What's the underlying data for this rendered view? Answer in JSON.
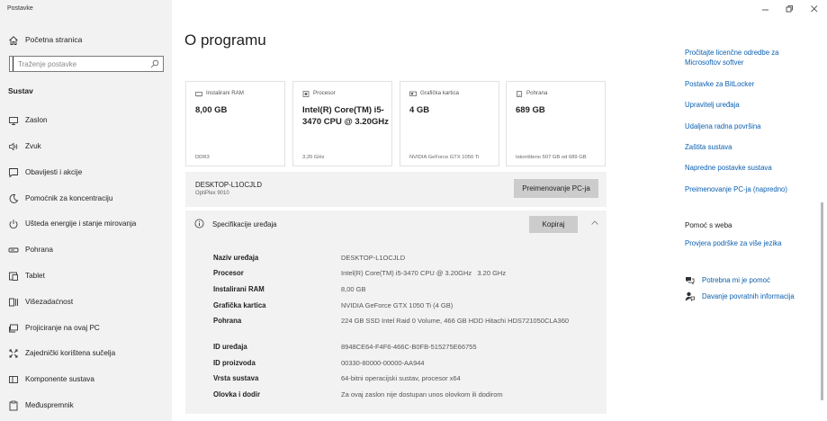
{
  "app": {
    "title": "Postavke"
  },
  "sidebar": {
    "home_label": "Početna stranica",
    "search_placeholder": "Traženje postavke",
    "section": "Sustav",
    "items": [
      {
        "label": "Zaslon",
        "icon": "monitor-icon"
      },
      {
        "label": "Zvuk",
        "icon": "speaker-icon"
      },
      {
        "label": "Obavijesti i akcije",
        "icon": "notification-icon"
      },
      {
        "label": "Pomoćnik za koncentraciju",
        "icon": "moon-icon"
      },
      {
        "label": "Ušteda energije i stanje mirovanja",
        "icon": "power-icon"
      },
      {
        "label": "Pohrana",
        "icon": "storage-icon"
      },
      {
        "label": "Tablet",
        "icon": "tablet-icon"
      },
      {
        "label": "Višezadaćnost",
        "icon": "multitask-icon"
      },
      {
        "label": "Projiciranje na ovaj PC",
        "icon": "projector-icon"
      },
      {
        "label": "Zajednički korištena sučelja",
        "icon": "shared-experiences-icon"
      },
      {
        "label": "Komponente sustava",
        "icon": "components-icon"
      },
      {
        "label": "Međuspremnik",
        "icon": "clipboard-icon"
      }
    ]
  },
  "main": {
    "title": "O programu",
    "cards": [
      {
        "title": "Instalirani RAM",
        "value": "8,00 GB",
        "footer": "DDR3",
        "icon": "ram-icon"
      },
      {
        "title": "Procesor",
        "value": "Intel(R) Core(TM) i5-3470 CPU @ 3.20GHz",
        "footer": "3,20 GHz",
        "icon": "cpu-icon"
      },
      {
        "title": "Grafička kartica",
        "value": "4 GB",
        "footer": "NVIDIA GeForce GTX 1050 Ti",
        "icon": "gpu-icon"
      },
      {
        "title": "Pohrana",
        "value": "689 GB",
        "footer": "Iskorišteno 507 GB od 689 GB",
        "icon": "drive-icon"
      }
    ],
    "device": {
      "name": "DESKTOP-L1OCJLD",
      "model": "OptiPlex 9010",
      "rename_label": "Preimenovanje PC-ja"
    },
    "specs": {
      "title": "Specifikacije uređaja",
      "copy_label": "Kopiraj",
      "rows": [
        {
          "key": "Naziv uređaja",
          "value": "DESKTOP-L1OCJLD"
        },
        {
          "key": "Procesor",
          "value": "Intel(R) Core(TM) i5-3470 CPU @ 3.20GHz   3.20 GHz"
        },
        {
          "key": "Instalirani RAM",
          "value": "8,00 GB"
        },
        {
          "key": "Grafička kartica",
          "value": "NVIDIA GeForce GTX 1050 Ti (4 GB)"
        },
        {
          "key": "Pohrana",
          "value": "224 GB SSD Intel Raid 0 Volume, 466 GB HDD Hitachi HDS721050CLA360"
        },
        {
          "key": "ID uređaja",
          "value": "8948CE64-F4F6-466C-B0FB-515275E66755"
        },
        {
          "key": "ID proizvoda",
          "value": "00330-80000-00000-AA944"
        },
        {
          "key": "Vrsta sustava",
          "value": "64-bitni operacijski sustav, procesor x64"
        },
        {
          "key": "Olovka i dodir",
          "value": "Za ovaj zaslon nije dostupan unos olovkom ili dodirom"
        }
      ]
    }
  },
  "related": {
    "links": [
      "Pročitajte licenčne odredbe za Microsoftov softver",
      "Postavke za BitLocker",
      "Upravitelj uređaja",
      "Udaljena radna površina",
      "Zaštita sustava",
      "Napredne postavke sustava",
      "Preimenovanje PC-ja (napredno)"
    ],
    "web_help_heading": "Pomoć s weba",
    "web_help_link": "Provjera podrške za više jezika",
    "help": [
      {
        "label": "Potrebna mi je pomoć",
        "icon": "help-chat-icon"
      },
      {
        "label": "Davanje povratnih informacija",
        "icon": "feedback-icon"
      }
    ]
  },
  "colors": {
    "accent": "#0a5fb0",
    "sidebar_bg": "#f2f2f2",
    "button_bg": "#cccccc"
  }
}
